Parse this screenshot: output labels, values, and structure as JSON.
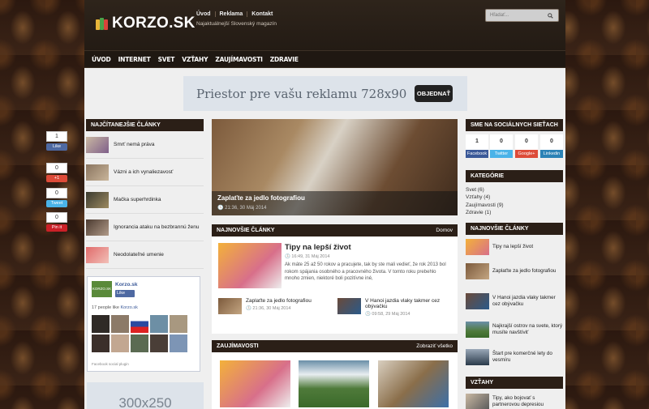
{
  "header": {
    "logo": "KORZO.SK",
    "links": [
      "Úvod",
      "Reklama",
      "Kontakt"
    ],
    "tagline": "Najaktuálnejší Slovenský magazín",
    "search_placeholder": "Hľadať..."
  },
  "nav": [
    "ÚVOD",
    "INTERNET",
    "SVET",
    "VZŤAHY",
    "ZAUJÍMAVOSTI",
    "ZDRAVIE"
  ],
  "ad_banner": {
    "text": "Priestor pre vašu reklamu 728x90",
    "button": "OBJEDNAŤ"
  },
  "share": {
    "fb_count": "1",
    "fb_label": "Like",
    "gplus_count": "0",
    "gplus_label": "+1",
    "tw_count": "0",
    "tw_label": "Tweet",
    "pin_count": "0",
    "pin_label": "Pin it"
  },
  "left": {
    "title": "NAJČÍTANEJŠIE ČLÁNKY",
    "items": [
      "Smrť nemá práva",
      "Vázni a ich vynaliezavosť",
      "Mačka superhrdinka",
      "Ignorancia ataku na bezbrannú ženu",
      "Neodolateľné umenie"
    ],
    "facebook": {
      "logo": "KORZO.SK",
      "name": "Korzo.sk",
      "like": "Like",
      "people_prefix": "17 people like ",
      "people_page": "Korzo.sk",
      "plugin": "Facebook social plugin"
    },
    "ad": "300x250"
  },
  "hero": {
    "title": "Zaplaťte za jedlo fotografiou",
    "meta": "21:36, 30 Máj 2014"
  },
  "latest": {
    "title": "NAJNOVŠIE ČLÁNKY",
    "right": "Domov",
    "featured": {
      "title": "Tipy na lepší život",
      "meta": "16:49, 31 Máj 2014",
      "excerpt": "Ak máte 25 až 50 rokov a pracujete, tak by ste mali vedieť, že rok 2013 bol rokom spájania osobného a pracovného života. V tomto roku prebehlo mnoho zmien, niektoré boli pozitívne iné,"
    },
    "mini1": {
      "title": "Zaplaťte za jedlo fotografiou",
      "meta": "21:36, 30 Máj 2014"
    },
    "mini2": {
      "title": "V Hanoi jazdia vlaky takmer cez obývačku",
      "meta": "09:58, 29 Máj 2014"
    }
  },
  "interests": {
    "title": "ZAUJÍMAVOSTI",
    "right": "Zobraziť všetko"
  },
  "social": {
    "title": "SME NA SOCIÁLNYCH SIEŤACH",
    "counts": [
      "1",
      "0",
      "0",
      "0"
    ],
    "labels": [
      "Facebook",
      "Twitter",
      "Google+",
      "Linkedin"
    ],
    "colors": [
      "#3b5998",
      "#4ab3e8",
      "#dd4b39",
      "#2b82b6"
    ]
  },
  "categories": {
    "title": "KATEGÓRIE",
    "items": [
      "Svet (6)",
      "Vzťahy (4)",
      "Zaujímavosti (9)",
      "Zdravie (1)"
    ]
  },
  "right_latest": {
    "title": "NAJNOVŠIE ČLÁNKY",
    "items": [
      "Tipy na lepší život",
      "Zaplaťte za jedlo fotografiou",
      "V Hanoi jazdia vlaky takmer cez obývačku",
      "Najkrajší ostrov na svete, ktorý musíte navštíviť",
      "Štart pre komerčné lety do vesmíru"
    ]
  },
  "relationships": {
    "title": "VZŤAHY",
    "item": "Tipy, ako bojovať s partnerovou depresiou"
  }
}
